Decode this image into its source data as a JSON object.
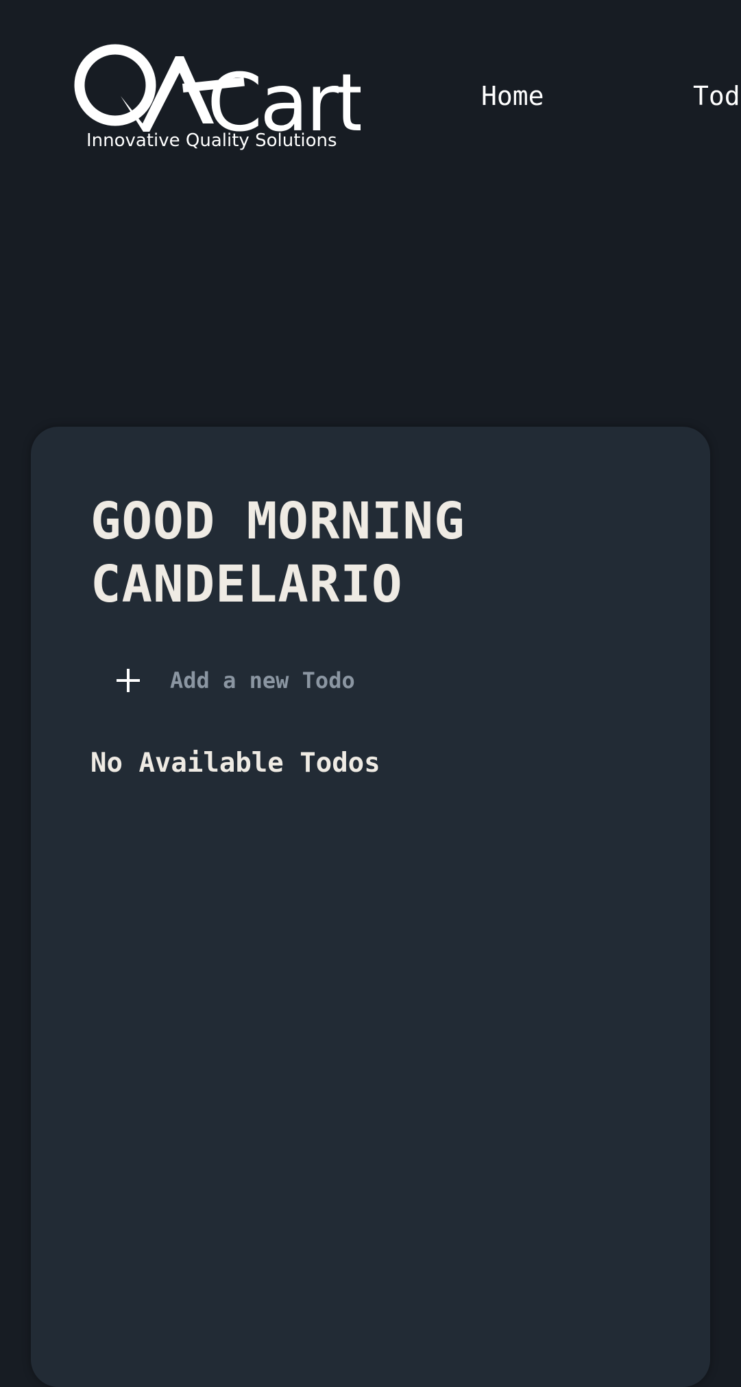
{
  "header": {
    "logo": {
      "wordmark": "QACart",
      "tagline": "Innovative Quality Solutions"
    },
    "nav": [
      {
        "label": "Home"
      },
      {
        "label": "Todo"
      }
    ]
  },
  "main": {
    "greeting_line1": "GOOD MORNING",
    "greeting_line2": "CANDELARIO",
    "new_todo": {
      "icon": "plus-icon",
      "placeholder": "Add a new Todo",
      "value": ""
    },
    "empty_message": "No Available Todos"
  },
  "colors": {
    "page_background": "#171c23",
    "card_background": "#222b35",
    "text": "#efebe4",
    "placeholder": "#8b96a2"
  }
}
